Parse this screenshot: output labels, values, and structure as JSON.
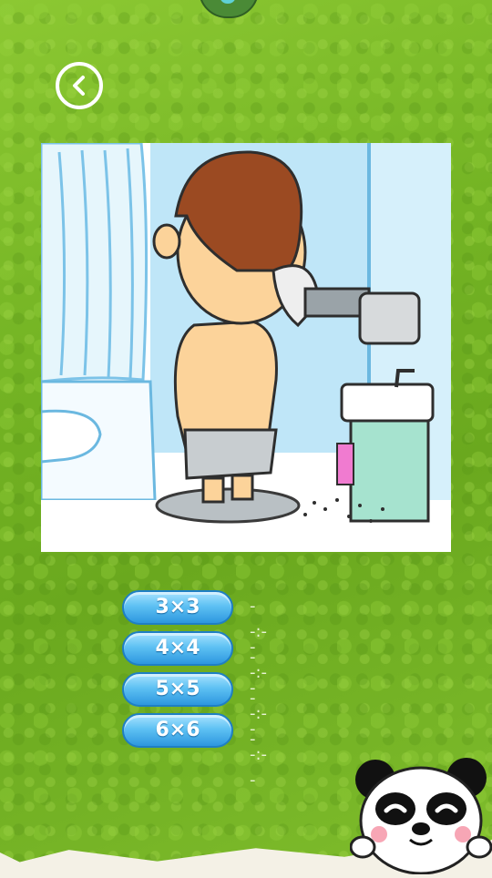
{
  "header": {
    "back_icon": "back-arrow-icon"
  },
  "puzzle": {
    "image": "cartoon-boy-haircut-machine-bathroom"
  },
  "levels": [
    {
      "label": "3×3",
      "best_time": "--:--"
    },
    {
      "label": "4×4",
      "best_time": "--:--"
    },
    {
      "label": "5×5",
      "best_time": "--:--"
    },
    {
      "label": "6×6",
      "best_time": "--:--"
    }
  ],
  "mascot": {
    "icon": "panda-mascot-icon"
  },
  "colors": {
    "grass": "#74b424",
    "button_blue": "#2d97df",
    "button_highlight": "#a9e3ff"
  }
}
